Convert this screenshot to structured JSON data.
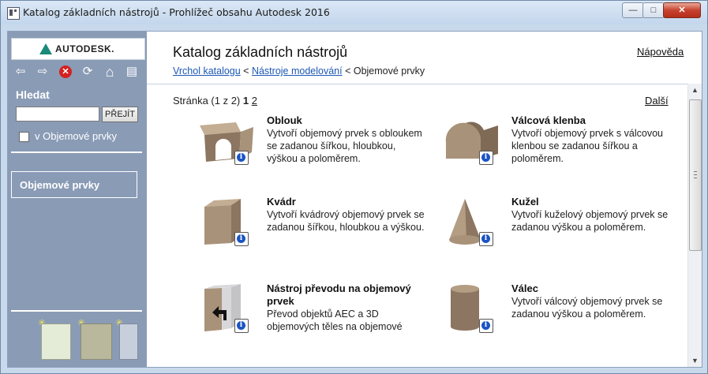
{
  "window": {
    "title": "Katalog základních nástrojů - Prohlížeč obsahu Autodesk 2016",
    "controls": {
      "minimize": "—",
      "maximize": "□",
      "close": "✕"
    }
  },
  "sidebar": {
    "logo_text": "AUTODESK.",
    "nav_icons": [
      "back-icon",
      "forward-icon",
      "stop-icon",
      "refresh-icon",
      "home-icon",
      "print-icon"
    ],
    "nav_glyphs": {
      "back": "⇦",
      "forward": "⇨",
      "stop": "✕",
      "refresh": "⟳",
      "home": "⌂",
      "print": "▤"
    },
    "search_label": "Hledat",
    "search_value": "",
    "go_button": "PŘEJÍT",
    "checkbox_label": "v Objemové prvky",
    "current_category": "Objemové prvky",
    "tool_icons": [
      "new-catalog-icon",
      "tool-palette-icon",
      "tool-icon"
    ]
  },
  "main": {
    "title": "Katalog základních nástrojů",
    "help_link": "Nápověda",
    "breadcrumb": {
      "link1": "Vrchol katalogu",
      "sep1": " < ",
      "link2": "Nástroje modelování",
      "sep2": " < ",
      "current": "Objemové prvky"
    },
    "pager": {
      "prefix": "Stránka (1 z 2) ",
      "current": "1",
      "other": "2"
    },
    "next_link": "Další",
    "items": [
      {
        "title": "Oblouk",
        "description": "Vytvoří objemový prvek s obloukem se zadanou šířkou, hloubkou, výškou a poloměrem.",
        "icon": "arch-icon"
      },
      {
        "title": "Válcová klenba",
        "description": "Vytvoří objemový prvek s válcovou klenbou se zadanou šířkou a poloměrem.",
        "icon": "barrel-vault-icon"
      },
      {
        "title": "Kvádr",
        "description": "Vytvoří kvádrový objemový prvek se zadanou šířkou, hloubkou a výškou.",
        "icon": "box-icon"
      },
      {
        "title": "Kužel",
        "description": "Vytvoří kuželový objemový prvek se zadanou výškou a poloměrem.",
        "icon": "cone-icon"
      },
      {
        "title": "Nástroj převodu na objemový prvek",
        "description": "Převod objektů AEC a 3D objemových těles na objemové",
        "icon": "convert-to-mass-icon"
      },
      {
        "title": "Válec",
        "description": "Vytvoří válcový objemový prvek se zadanou výškou a poloměrem.",
        "icon": "cylinder-icon"
      }
    ]
  },
  "colors": {
    "sidebar": "#8a9bb6",
    "link": "#1c57b5",
    "mass": "#a89279",
    "info": "#1b54c3"
  }
}
